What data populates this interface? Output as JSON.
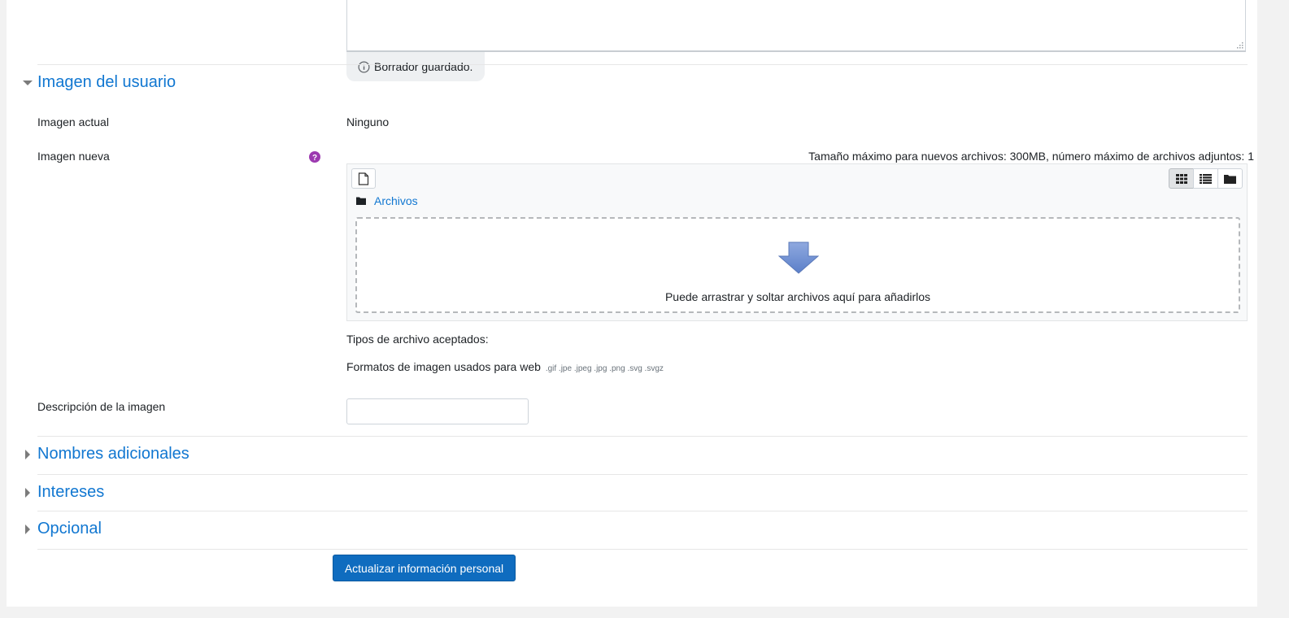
{
  "draft": {
    "status_text": "Borrador guardado.",
    "icon": "info-circle-icon"
  },
  "sections": {
    "user_picture": {
      "title": "Imagen del usuario",
      "expanded": true
    },
    "additional_names": {
      "title": "Nombres adicionales",
      "expanded": false
    },
    "interests": {
      "title": "Intereses",
      "expanded": false
    },
    "optional": {
      "title": "Opcional",
      "expanded": false
    }
  },
  "fields": {
    "current_picture": {
      "label": "Imagen actual",
      "value": "Ninguno"
    },
    "new_picture": {
      "label": "Imagen nueva",
      "help_icon": "question-circle-icon"
    },
    "image_description": {
      "label": "Descripción de la imagen",
      "value": ""
    }
  },
  "filemanager": {
    "limits_text": "Tamaño máximo para nuevos archivos: 300MB, número máximo de archivos adjuntos: 1",
    "path_label": "Archivos",
    "drop_text": "Puede arrastrar y soltar archivos aquí para añadirlos",
    "active_view": "icons",
    "views": [
      "icons",
      "list",
      "tree"
    ]
  },
  "accepted_types": {
    "heading": "Tipos de archivo aceptados:",
    "group_label": "Formatos de imagen usados para web",
    "extensions": ".gif .jpe .jpeg .jpg .png .svg .svgz"
  },
  "submit": {
    "label": "Actualizar información personal"
  },
  "colors": {
    "link": "#1177d1",
    "primary": "#0f6cbf",
    "help": "#9c3ab0"
  }
}
